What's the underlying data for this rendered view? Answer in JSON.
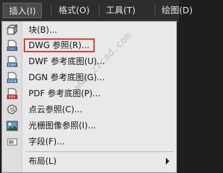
{
  "menubar": {
    "items": [
      {
        "label": "插入(I)",
        "active": true
      },
      {
        "label": "格式(O)",
        "active": false
      },
      {
        "label": "工具(T)",
        "active": false
      },
      {
        "label": "绘图(D)",
        "active": false
      }
    ]
  },
  "menu": {
    "items": [
      {
        "label": "块(B)...",
        "icon": "block-icon"
      },
      {
        "label": "DWG 参照(R)...",
        "icon": "dwg-reference-icon",
        "highlighted": true
      },
      {
        "label": "DWF 参考底图(U)...",
        "icon": "dwf-underlay-icon"
      },
      {
        "label": "DGN 参考底图(G)...",
        "icon": "dgn-underlay-icon"
      },
      {
        "label": "PDF 参考底图(P)...",
        "icon": "pdf-underlay-icon"
      },
      {
        "label": "点云参照(C)...",
        "icon": "point-cloud-icon"
      },
      {
        "label": "光栅图像参照(I)...",
        "icon": "raster-image-icon"
      },
      {
        "label": "字段(F)...",
        "icon": "field-icon"
      },
      {
        "label": "布局(L)",
        "icon": "",
        "submenu": true
      }
    ]
  },
  "colors": {
    "highlight_border": "#e03a2a",
    "menubar_bg": "#2e2e2e",
    "menu_bg": "#e9e9e9"
  },
  "watermark": "www.zzcad.com"
}
